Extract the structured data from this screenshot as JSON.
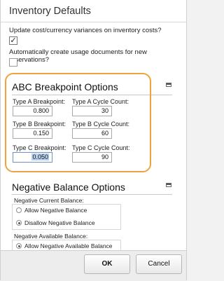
{
  "dialog": {
    "title": "Inventory Defaults"
  },
  "options": {
    "update_variances": {
      "label": "Update cost/currency variances on inventory costs?",
      "checked": true,
      "check_glyph": "✓"
    },
    "usage_documents": {
      "label": "Automatically create usage documents for new reservations?",
      "checked": false
    }
  },
  "abc": {
    "title": "ABC Breakpoint Options",
    "fields": [
      {
        "label": "Type A Breakpoint:",
        "value": "0.800"
      },
      {
        "label": "Type A Cycle Count:",
        "value": "30"
      },
      {
        "label": "Type B Breakpoint:",
        "value": "0.150"
      },
      {
        "label": "Type B Cycle Count:",
        "value": "60"
      },
      {
        "label": "Type C Breakpoint:",
        "value": "0.050",
        "focused": true
      },
      {
        "label": "Type C Cycle Count:",
        "value": "90"
      }
    ],
    "highlight_color": "#f0a33a"
  },
  "negative": {
    "title": "Negative Balance Options",
    "current": {
      "label": "Negative Current Balance:",
      "options": [
        {
          "label": "Allow Negative Balance",
          "selected": false
        },
        {
          "label": "Disallow Negative Balance",
          "selected": true
        }
      ]
    },
    "available": {
      "label": "Negative Available Balance:",
      "options": [
        {
          "label": "Allow Negative Available Balance",
          "selected": true
        }
      ]
    }
  },
  "footer": {
    "ok_label": "OK",
    "cancel_label": "Cancel"
  },
  "icons": {
    "collapse": "collapse-section-icon"
  }
}
